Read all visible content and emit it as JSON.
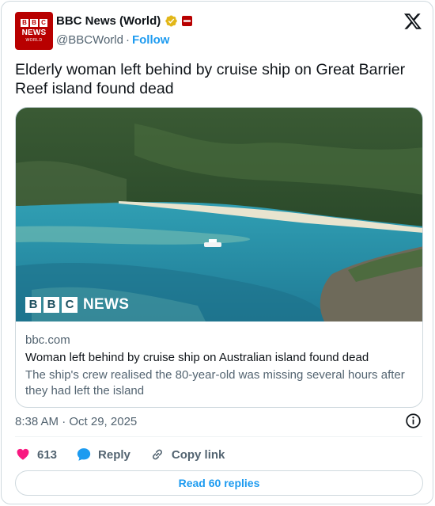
{
  "author": {
    "display_name": "BBC News (World)",
    "handle": "@BBCWorld",
    "separator": "·",
    "follow_label": "Follow",
    "avatar_letters": [
      "B",
      "B",
      "C"
    ],
    "avatar_line1": "NEWS",
    "avatar_line2": "WORLD"
  },
  "tweet": {
    "text": "Elderly woman left behind by cruise ship on Great Barrier Reef island found dead",
    "timestamp": "8:38 AM · Oct 29, 2025"
  },
  "card": {
    "watermark_letters": [
      "B",
      "B",
      "C"
    ],
    "watermark_word": "NEWS",
    "domain": "bbc.com",
    "title": "Woman left behind by cruise ship on Australian island found dead",
    "description": "The ship's crew realised the 80-year-old was missing several hours after they had left the island"
  },
  "actions": {
    "likes": "613",
    "reply_label": "Reply",
    "copy_link_label": "Copy link"
  },
  "replies_button": "Read 60 replies",
  "colors": {
    "accent": "#1d9bf0",
    "like": "#f91880",
    "bbc_red": "#b80000",
    "verified_gold": "#e2b719",
    "secondary_text": "#536471"
  },
  "icons": {
    "verified": "verified-gold-badge-icon",
    "affiliate": "bbc-affiliate-icon",
    "platform": "x-logo-icon",
    "info": "info-icon",
    "like": "heart-icon",
    "reply": "speech-bubble-icon",
    "copy_link": "link-icon"
  }
}
